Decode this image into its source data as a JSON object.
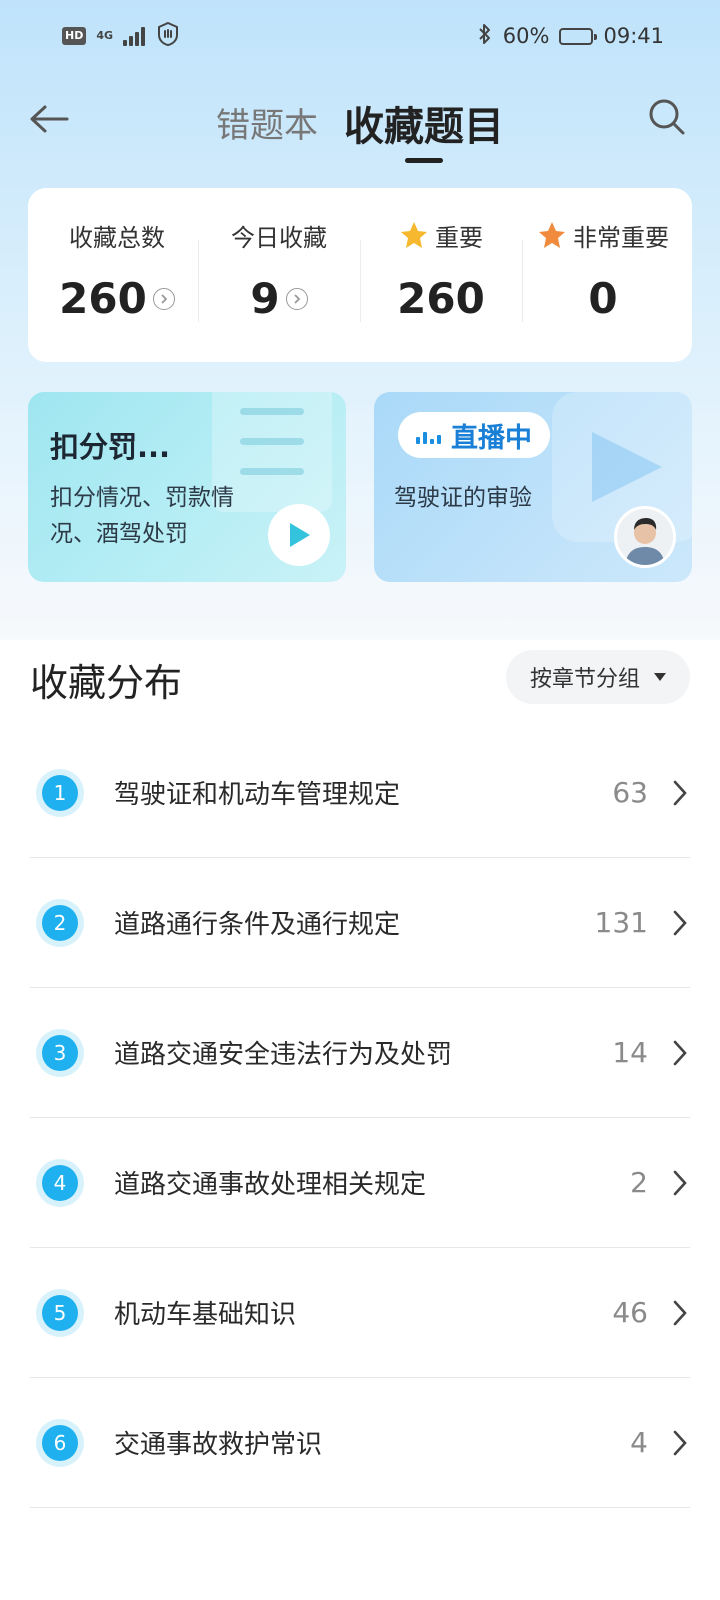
{
  "status_bar": {
    "hd": "HD",
    "network": "4G",
    "battery_percent": "60%",
    "battery_level": 0.6,
    "time": "09:41"
  },
  "header": {
    "tabs": [
      {
        "label": "错题本",
        "active": false
      },
      {
        "label": "收藏题目",
        "active": true
      }
    ]
  },
  "stats": [
    {
      "label": "收藏总数",
      "value": "260"
    },
    {
      "label": "今日收藏",
      "value": "9"
    },
    {
      "label": "重要",
      "value": "260"
    },
    {
      "label": "非常重要",
      "value": "0"
    }
  ],
  "promos": {
    "left": {
      "title": "扣分罚...",
      "desc": "扣分情况、罚款情况、酒驾处罚"
    },
    "right": {
      "badge": "直播中",
      "desc": "驾驶证的审验"
    }
  },
  "distribution": {
    "title": "收藏分布",
    "group_button": "按章节分组",
    "items": [
      {
        "num": "1",
        "label": "驾驶证和机动车管理规定",
        "count": "63"
      },
      {
        "num": "2",
        "label": "道路通行条件及通行规定",
        "count": "131"
      },
      {
        "num": "3",
        "label": "道路交通安全违法行为及处罚",
        "count": "14"
      },
      {
        "num": "4",
        "label": "道路交通事故处理相关规定",
        "count": "2"
      },
      {
        "num": "5",
        "label": "机动车基础知识",
        "count": "46"
      },
      {
        "num": "6",
        "label": "交通事故救护常识",
        "count": "4"
      }
    ]
  },
  "colors": {
    "accent": "#1eb0ef",
    "live_text": "#1a7fd6",
    "star_gold": "#f5b82e",
    "star_orange": "#f08a3c"
  }
}
